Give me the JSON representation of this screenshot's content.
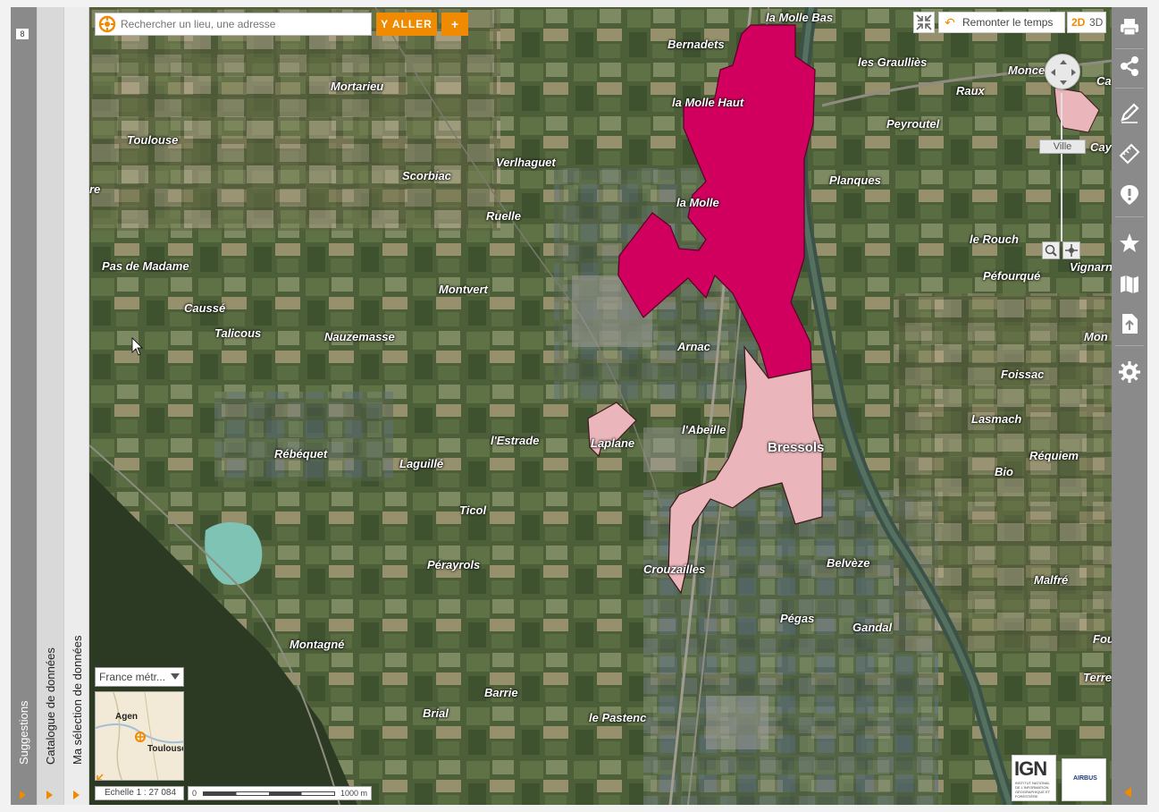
{
  "left_panels": {
    "suggestions_label": "Suggestions",
    "suggestions_count": "8",
    "catalog_label": "Catalogue de données",
    "selection_label": "Ma sélection de données"
  },
  "search": {
    "placeholder": "Rechercher un lieu, une adresse",
    "go_label": "Y ALLER",
    "add_label": "+"
  },
  "top_controls": {
    "time_label": "Remonter le temps",
    "view_2d": "2D",
    "view_3d": "3D"
  },
  "zoom": {
    "level_label": "Ville"
  },
  "toolbar": {
    "icons": [
      "print-icon",
      "share-icon",
      "draw-icon",
      "measure-icon",
      "alert-icon",
      "favorite-icon",
      "map-layers-icon",
      "import-icon",
      "settings-icon"
    ]
  },
  "map": {
    "places": [
      {
        "name": "la Molle Bas"
      },
      {
        "name": "Bernadets"
      },
      {
        "name": "Mortarieu"
      },
      {
        "name": "la Molle Haut"
      },
      {
        "name": "les Graulliès"
      },
      {
        "name": "Raux"
      },
      {
        "name": "Monce"
      },
      {
        "name": "Ca"
      },
      {
        "name": "Peyroutel"
      },
      {
        "name": "Toulouse"
      },
      {
        "name": "Verlhaguet"
      },
      {
        "name": "Cay"
      },
      {
        "name": "Scorbiac"
      },
      {
        "name": "re"
      },
      {
        "name": "la Molle"
      },
      {
        "name": "Planques"
      },
      {
        "name": "Ruelle"
      },
      {
        "name": "le Rouch"
      },
      {
        "name": "Vignarna"
      },
      {
        "name": "Pas de Madame"
      },
      {
        "name": "Péfourqué"
      },
      {
        "name": "Montvert"
      },
      {
        "name": "Caussé"
      },
      {
        "name": "Talicous"
      },
      {
        "name": "Nauzemasse"
      },
      {
        "name": "Mon"
      },
      {
        "name": "Arnac"
      },
      {
        "name": "Foissac"
      },
      {
        "name": "Lasmach"
      },
      {
        "name": "l'Abeille"
      },
      {
        "name": "l'Estrade"
      },
      {
        "name": "Laplane"
      },
      {
        "name": "Bressols"
      },
      {
        "name": "Rébéquet"
      },
      {
        "name": "Laguillé"
      },
      {
        "name": "Réquiem"
      },
      {
        "name": "Bio"
      },
      {
        "name": "Ticol"
      },
      {
        "name": "Pérayrols"
      },
      {
        "name": "Crouzailles"
      },
      {
        "name": "Belvèze"
      },
      {
        "name": "Malfré"
      },
      {
        "name": "Pégas"
      },
      {
        "name": "Gandal"
      },
      {
        "name": "Fou"
      },
      {
        "name": "Montagné"
      },
      {
        "name": "Terre"
      },
      {
        "name": "Barrie"
      },
      {
        "name": "Brial"
      },
      {
        "name": "le Pastenc"
      }
    ],
    "colors": {
      "commune_selected": "#d1005f",
      "commune_pale": "#eab5bb",
      "accent": "#f08a00"
    }
  },
  "bottom_left": {
    "projection": "France métr...",
    "overview_labels": [
      "Agen",
      "Toulouse"
    ],
    "scale_text": "Echelle 1 : 27 084",
    "scale_zero": "0",
    "scale_end": "1000 m"
  },
  "logos": {
    "ign": "IGN",
    "ign_sub": "INSTITUT NATIONAL DE L'INFORMATION GÉOGRAPHIQUE ET FORESTIÈRE",
    "airbus": "AIRBUS"
  }
}
